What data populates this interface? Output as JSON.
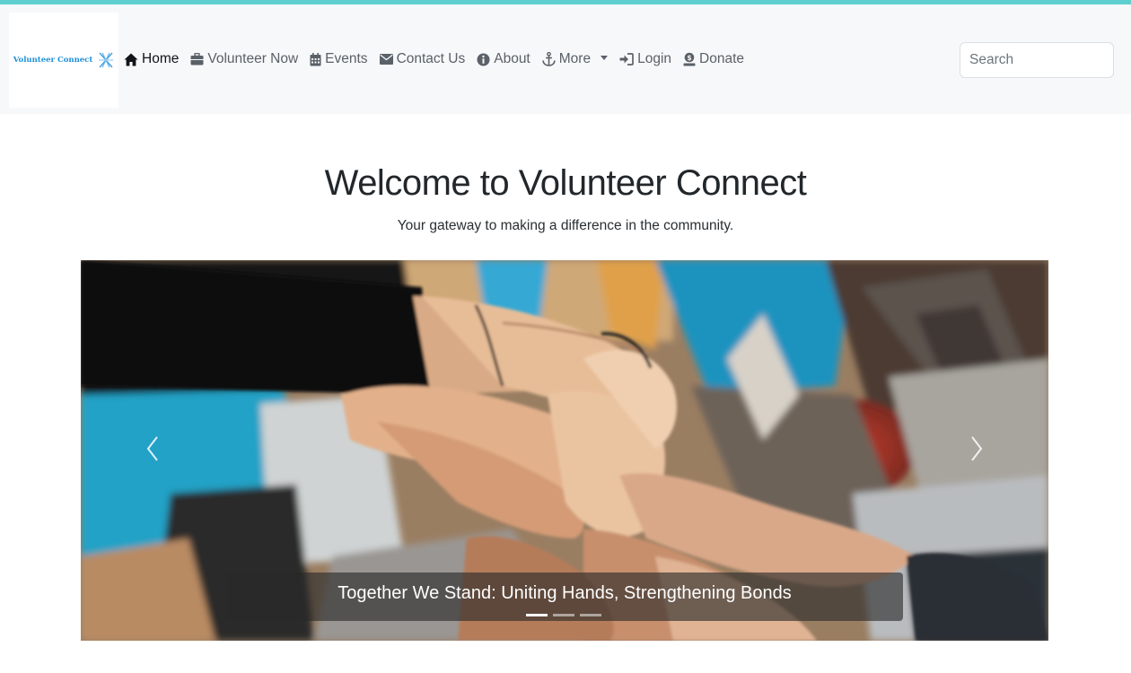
{
  "brand": {
    "name": "Volunteer Connect",
    "icon": "sparkle-x-logo"
  },
  "nav": {
    "items": [
      {
        "label": "Home",
        "icon": "home-icon",
        "active": true
      },
      {
        "label": "Volunteer Now",
        "icon": "briefcase-icon"
      },
      {
        "label": "Events",
        "icon": "calendar-icon"
      },
      {
        "label": "Contact Us",
        "icon": "envelope-icon"
      },
      {
        "label": "About",
        "icon": "info-circle-icon"
      },
      {
        "label": "More",
        "icon": "anchor-icon",
        "dropdown": true
      },
      {
        "label": "Login",
        "icon": "sign-in-icon"
      },
      {
        "label": "Donate",
        "icon": "donate-icon"
      }
    ],
    "search": {
      "placeholder": "Search",
      "value": ""
    }
  },
  "hero": {
    "title": "Welcome to Volunteer Connect",
    "subtitle": "Your gateway to making a difference in the community."
  },
  "carousel": {
    "caption": "Together We Stand: Uniting Hands, Strengthening Bonds",
    "slide_count": 3,
    "active_index": 0,
    "prev_icon": "chevron-left-icon",
    "next_icon": "chevron-right-icon"
  },
  "colors": {
    "accent": "#5fd0cf",
    "brand": "#1e8fd8",
    "navbar_bg": "#f7f8f9"
  }
}
